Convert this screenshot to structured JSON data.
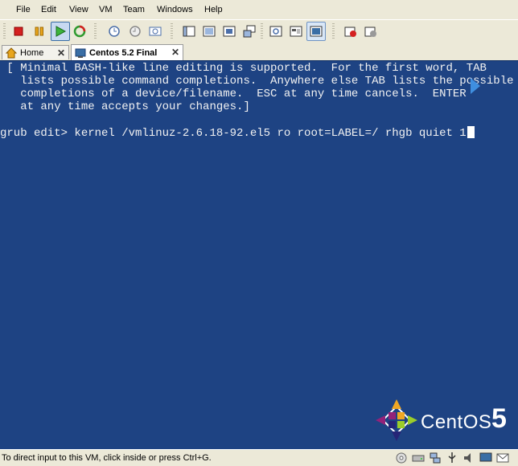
{
  "menu": [
    "File",
    "Edit",
    "View",
    "VM",
    "Team",
    "Windows",
    "Help"
  ],
  "toolbar": {
    "buttons": [
      "stop-icon",
      "pause-icon",
      "play-icon",
      "reset-icon",
      "snapshot-icon",
      "revert-snapshot-icon",
      "snapshot-manager-icon",
      "normal-view-icon",
      "full-screen-icon",
      "quick-switch-icon",
      "summary-view-icon",
      "console-view-icon",
      "appliance-view-icon",
      "show-console-icon",
      "capture-movie-icon",
      "settings-icon"
    ],
    "active": "play-icon"
  },
  "tabs": [
    {
      "label": "Home",
      "icon": "home-icon",
      "active": false
    },
    {
      "label": "Centos 5.2 Final",
      "icon": "vm-icon",
      "active": true
    }
  ],
  "console": {
    "lines": [
      " [ Minimal BASH-like line editing is supported.  For the first word, TAB",
      "   lists possible command completions.  Anywhere else TAB lists the possible",
      "   completions of a device/filename.  ESC at any time cancels.  ENTER",
      "   at any time accepts your changes.]",
      "",
      "grub edit> kernel /vmlinuz-2.6.18-92.el5 ro root=LABEL=/ rhgb quiet 1"
    ]
  },
  "branding": {
    "logo_text": "CentOS",
    "logo_number": "5"
  },
  "status": {
    "text": "To direct input to this VM, click inside or press Ctrl+G.",
    "icons": [
      "cd-icon",
      "hdd-icon",
      "network-icon",
      "usb-icon",
      "sound-icon",
      "display-icon",
      "message-icon"
    ]
  },
  "colors": {
    "console_bg": "#1e4383",
    "chrome_bg": "#ece9d8"
  }
}
